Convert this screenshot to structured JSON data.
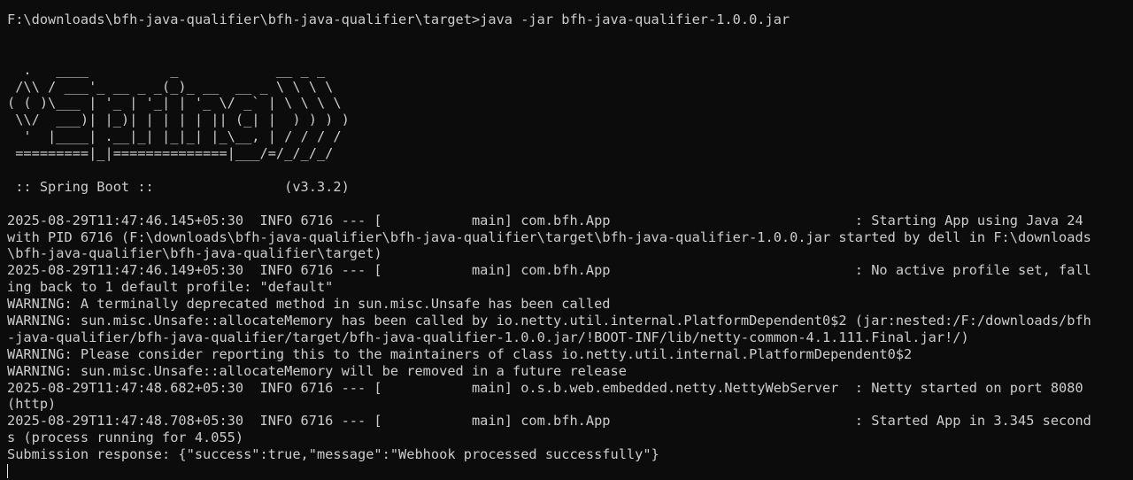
{
  "terminal": {
    "prompt_line": "F:\\downloads\\bfh-java-qualifier\\bfh-java-qualifier\\target>java -jar bfh-java-qualifier-1.0.0.jar",
    "banner": [
      "  .   ____          _            __ _ _",
      " /\\\\ / ___'_ __ _ _(_)_ __  __ _ \\ \\ \\ \\",
      "( ( )\\___ | '_ | '_| | '_ \\/ _` | \\ \\ \\ \\",
      " \\\\/  ___)| |_)| | | | | || (_| |  ) ) ) )",
      "  '  |____| .__|_| |_|_| |_\\__, | / / / /",
      " =========|_|==============|___/=/_/_/_/"
    ],
    "spring_line": " :: Spring Boot ::                (v3.3.2)",
    "log_lines": [
      "2025-08-29T11:47:46.145+05:30  INFO 6716 --- [           main] com.bfh.App                              : Starting App using Java 24",
      "with PID 6716 (F:\\downloads\\bfh-java-qualifier\\bfh-java-qualifier\\target\\bfh-java-qualifier-1.0.0.jar started by dell in F:\\downloads",
      "\\bfh-java-qualifier\\bfh-java-qualifier\\target)",
      "2025-08-29T11:47:46.149+05:30  INFO 6716 --- [           main] com.bfh.App                              : No active profile set, fall",
      "ing back to 1 default profile: \"default\"",
      "WARNING: A terminally deprecated method in sun.misc.Unsafe has been called",
      "WARNING: sun.misc.Unsafe::allocateMemory has been called by io.netty.util.internal.PlatformDependent0$2 (jar:nested:/F:/downloads/bfh",
      "-java-qualifier/bfh-java-qualifier/target/bfh-java-qualifier-1.0.0.jar/!BOOT-INF/lib/netty-common-4.1.111.Final.jar!/)",
      "WARNING: Please consider reporting this to the maintainers of class io.netty.util.internal.PlatformDependent0$2",
      "WARNING: sun.misc.Unsafe::allocateMemory will be removed in a future release",
      "2025-08-29T11:47:48.682+05:30  INFO 6716 --- [           main] o.s.b.web.embedded.netty.NettyWebServer  : Netty started on port 8080",
      "(http)",
      "2025-08-29T11:47:48.708+05:30  INFO 6716 --- [           main] com.bfh.App                              : Started App in 3.345 second",
      "s (process running for 4.055)",
      "Submission response: {\"success\":true,\"message\":\"Webhook processed successfully\"}"
    ]
  }
}
